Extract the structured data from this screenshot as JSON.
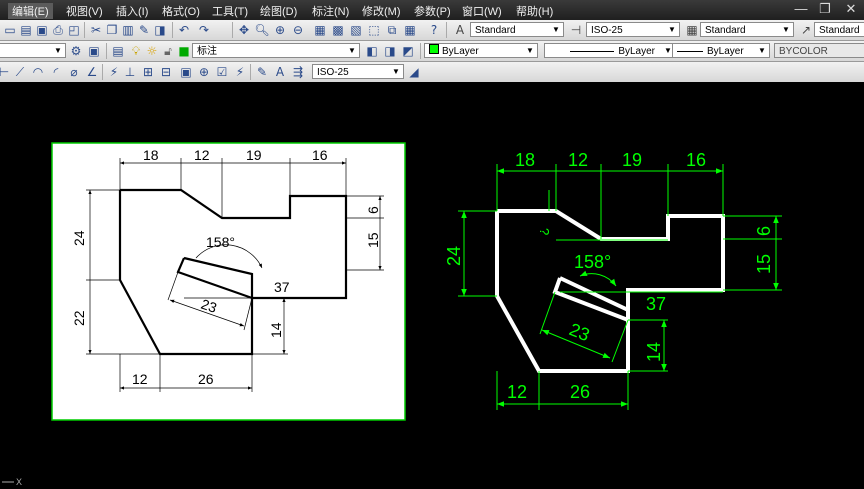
{
  "menu": {
    "items": [
      "编辑(E)",
      "视图(V)",
      "插入(I)",
      "格式(O)",
      "工具(T)",
      "绘图(D)",
      "标注(N)",
      "修改(M)",
      "参数(P)",
      "窗口(W)",
      "帮助(H)"
    ]
  },
  "window_controls": {
    "minimize": "—",
    "restore": "❐",
    "close": "✕"
  },
  "toolbar1": {
    "text_style": "Standard",
    "dim_style": "ISO-25",
    "table_style": "Standard",
    "multileader_style": "Standard"
  },
  "toolbar2": {
    "layer": "标注",
    "color": "ByLayer",
    "linetype": "ByLayer",
    "lineweight": "ByLayer",
    "plotstyle": "BYCOLOR"
  },
  "toolbar3": {
    "dim_style": "ISO-25"
  },
  "colors": {
    "accent_green": "#00ff00",
    "background": "#000000",
    "geometry": "#ffffff",
    "viewport_border": "#00cc00"
  },
  "left_figure": {
    "dims": {
      "top1": "18",
      "top2": "12",
      "top3": "19",
      "top4": "16",
      "left_upper": "24",
      "left_lower": "22",
      "right_upper": "6",
      "right_lower": "15",
      "angle": "158°",
      "inner": "23",
      "bottom_long": "37",
      "right_bottom": "14",
      "bottom1": "12",
      "bottom2": "26"
    }
  },
  "right_figure": {
    "dims": {
      "top1": "18",
      "top2": "12",
      "top3": "19",
      "top4": "16",
      "left": "24",
      "right_upper": "6",
      "right_lower": "15",
      "angle": "158°",
      "question": "?",
      "inner": "23",
      "bottom_long": "37",
      "right_bottom": "14",
      "bottom1": "12",
      "bottom2": "26"
    }
  },
  "status": {
    "axis_label": "X"
  }
}
